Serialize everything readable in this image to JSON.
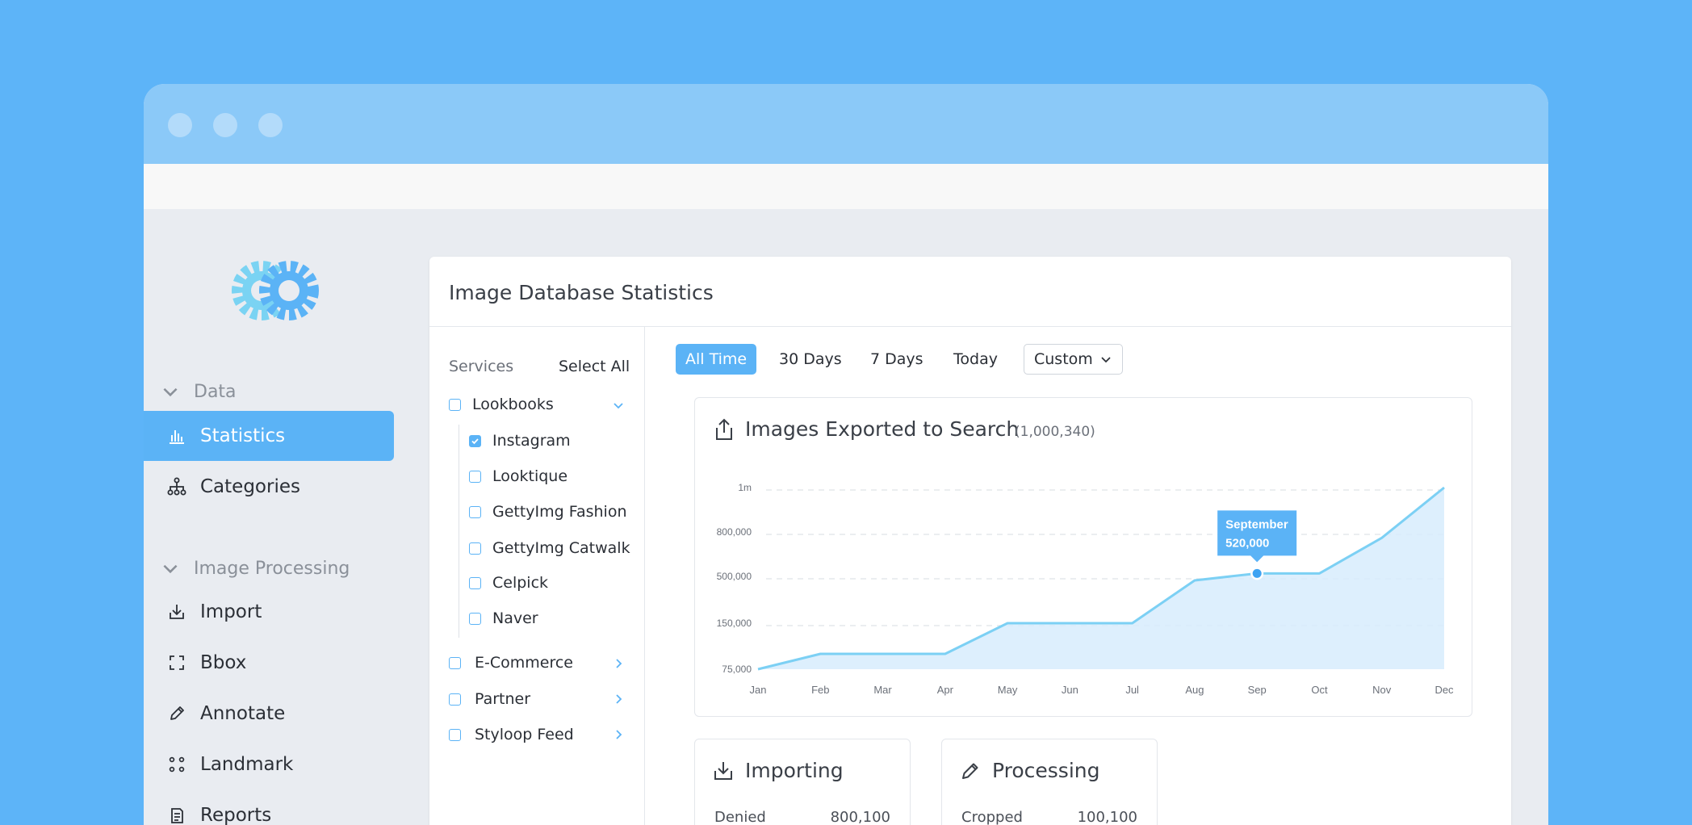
{
  "sidebar": {
    "sections": [
      {
        "label": "Data"
      },
      {
        "label": "Image Processing"
      }
    ],
    "items": [
      {
        "label": "Statistics",
        "icon": "bar-chart-icon",
        "active": true
      },
      {
        "label": "Categories",
        "icon": "hierarchy-icon"
      },
      {
        "label": "Import",
        "icon": "import-icon"
      },
      {
        "label": "Bbox",
        "icon": "bbox-icon"
      },
      {
        "label": "Annotate",
        "icon": "pencil-icon"
      },
      {
        "label": "Landmark",
        "icon": "landmark-icon"
      },
      {
        "label": "Reports",
        "icon": "document-icon"
      }
    ]
  },
  "panel": {
    "title": "Image Database Statistics"
  },
  "services": {
    "header": "Services",
    "select_all": "Select All",
    "groups": [
      {
        "label": "Lookbooks",
        "checked": false,
        "expanded": true
      },
      {
        "label": "E-Commerce",
        "checked": false
      },
      {
        "label": "Partner",
        "checked": false
      },
      {
        "label": "Styloop Feed",
        "checked": false
      }
    ],
    "children": [
      {
        "label": "Instagram",
        "checked": true
      },
      {
        "label": "Looktique",
        "checked": false
      },
      {
        "label": "GettyImg Fashion",
        "checked": false
      },
      {
        "label": "GettyImg Catwalk",
        "checked": false
      },
      {
        "label": "Celpick",
        "checked": false
      },
      {
        "label": "Naver",
        "checked": false
      }
    ]
  },
  "time_filters": {
    "all_time": "All Time",
    "days30": "30 Days",
    "days7": "7 Days",
    "today": "Today",
    "custom": "Custom",
    "selected": "All Time"
  },
  "chart": {
    "title": "Images Exported to Search",
    "count": "(1,000,340)",
    "tooltip_month": "September",
    "tooltip_value": "520,000"
  },
  "chart_data": {
    "type": "area",
    "categories": [
      "Jan",
      "Feb",
      "Mar",
      "Apr",
      "May",
      "Jun",
      "Jul",
      "Aug",
      "Sep",
      "Oct",
      "Nov",
      "Dec"
    ],
    "y_ticks": [
      "75,000",
      "150,000",
      "500,000",
      "800,000",
      "1m"
    ],
    "y_tick_values": [
      75000,
      150000,
      500000,
      800000,
      1000000
    ],
    "values": [
      75000,
      100000,
      100000,
      100000,
      150000,
      150000,
      150000,
      470000,
      520000,
      520000,
      760000,
      1000000
    ],
    "highlight": {
      "category": "Sep",
      "label": "September",
      "value": "520,000"
    },
    "grid": true,
    "colors": {
      "line": "#7cd0f4",
      "fill": "#d7ecfd",
      "point": "#3fa3f2"
    }
  },
  "cards": [
    {
      "title": "Importing",
      "icon": "import-icon",
      "label": "Denied",
      "value": "800,100"
    },
    {
      "title": "Processing",
      "icon": "pencil-icon",
      "label": "Cropped",
      "value": "100,100"
    }
  ],
  "colors": {
    "accent": "#5bb3f6",
    "background": "#5db4f8",
    "titlebar": "#8bc9f8"
  }
}
